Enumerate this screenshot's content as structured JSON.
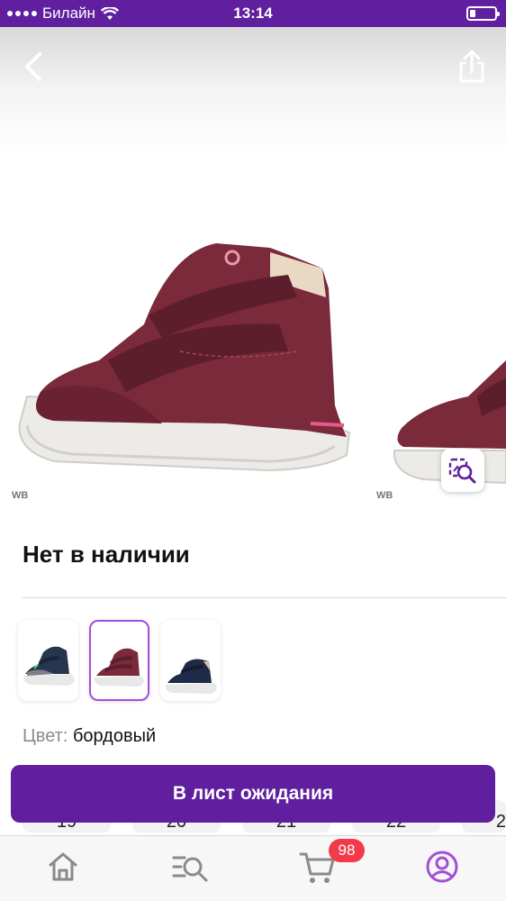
{
  "status_bar": {
    "carrier": "Билайн",
    "time": "13:14"
  },
  "gallery": {
    "watermarks": [
      "WB",
      "WB"
    ],
    "icons": {
      "back": "chevron-left-icon",
      "share": "share-icon",
      "photo_search": "image-search-icon"
    }
  },
  "product": {
    "availability": "Нет в наличии",
    "color_label": "Цвет:",
    "color_value": "бордовый",
    "variants": [
      {
        "color": "navy-grey"
      },
      {
        "color": "burgundy",
        "selected": true
      },
      {
        "color": "navy"
      }
    ],
    "size_values_partially_visible": [
      "19",
      "20",
      "21",
      "22",
      "2"
    ]
  },
  "actions": {
    "waitlist_button": "В лист ожидания"
  },
  "tab_bar": {
    "items": [
      {
        "id": "home",
        "icon": "home-icon"
      },
      {
        "id": "catalog",
        "icon": "search-list-icon"
      },
      {
        "id": "cart",
        "icon": "cart-icon",
        "badge": "98"
      },
      {
        "id": "profile",
        "icon": "profile-icon",
        "active": true
      }
    ]
  },
  "colors": {
    "brand": "#5f1f9e",
    "accent": "#a24fd8",
    "badge": "#f23a4b",
    "product": "#7a2a3a"
  }
}
